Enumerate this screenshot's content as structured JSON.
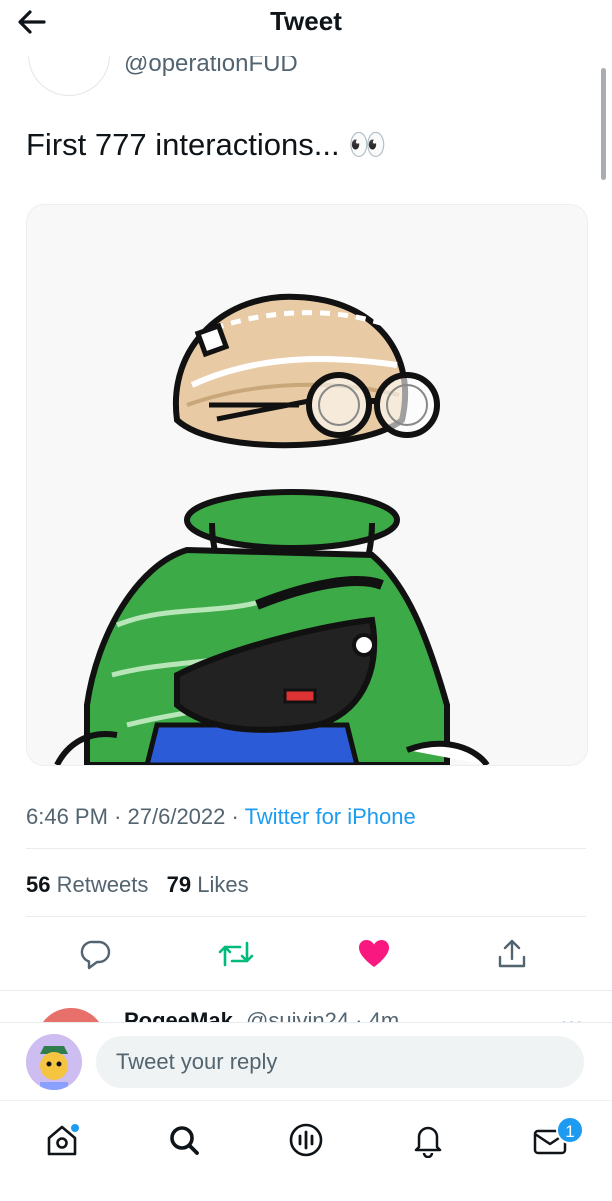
{
  "header": {
    "title": "Tweet",
    "back_icon": "arrow-left-icon"
  },
  "author": {
    "handle": "@operationFUD"
  },
  "tweet": {
    "text": "First 777 interactions... 👀",
    "time": "6:46 PM",
    "date": "27/6/2022",
    "source": "Twitter for iPhone",
    "retweets_count": "56",
    "retweets_label": "Retweets",
    "likes_count": "79",
    "likes_label": "Likes"
  },
  "actions": {
    "reply_icon": "comment-icon",
    "retweet_icon": "retweet-icon",
    "like_icon": "heart-filled-icon",
    "share_icon": "share-icon"
  },
  "reply_preview": {
    "name": "PogeeMak",
    "handle": "@suivin24 · 4m"
  },
  "compose": {
    "placeholder": "Tweet your reply"
  },
  "tabbar": {
    "items": [
      "home-icon",
      "search-icon",
      "spaces-icon",
      "notifications-icon",
      "messages-icon"
    ],
    "messages_badge": "1"
  },
  "colors": {
    "accent": "#1d9bf0",
    "retweet": "#00ba7c",
    "like": "#f91880",
    "muted": "#536471"
  }
}
